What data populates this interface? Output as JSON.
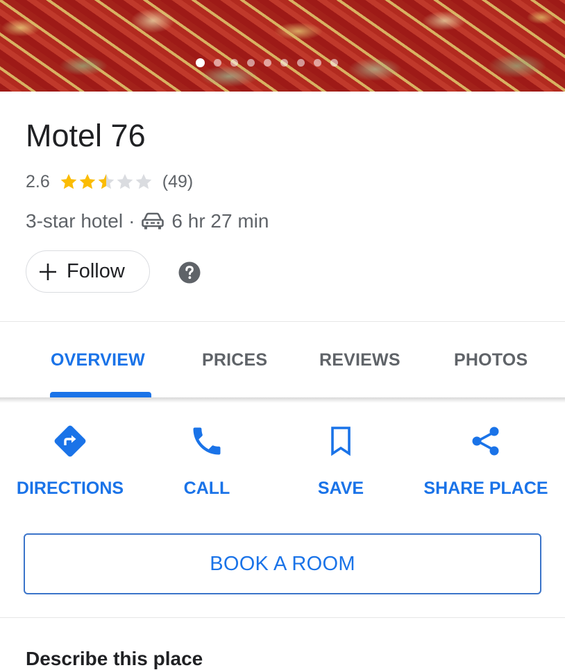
{
  "hero": {
    "image_count": 9,
    "active_index": 0
  },
  "place": {
    "name": "Motel 76",
    "rating": "2.6",
    "rating_value": 2.6,
    "review_count": "(49)",
    "category": "3-star hotel",
    "separator": "·",
    "drive_time": "6 hr 27 min"
  },
  "follow": {
    "label": "Follow"
  },
  "tabs": [
    {
      "label": "OVERVIEW",
      "active": true
    },
    {
      "label": "PRICES",
      "active": false
    },
    {
      "label": "REVIEWS",
      "active": false
    },
    {
      "label": "PHOTOS",
      "active": false
    }
  ],
  "actions": [
    {
      "label": "DIRECTIONS",
      "icon": "directions-icon"
    },
    {
      "label": "CALL",
      "icon": "phone-icon"
    },
    {
      "label": "SAVE",
      "icon": "bookmark-icon"
    },
    {
      "label": "SHARE PLACE",
      "icon": "share-icon"
    }
  ],
  "book": {
    "label": "BOOK A ROOM"
  },
  "describe": {
    "heading": "Describe this place"
  },
  "colors": {
    "accent": "#1a73e8",
    "star_filled": "#fbbc04",
    "star_empty": "#dadce0",
    "secondary_text": "#5f6368",
    "primary_text": "#202124"
  }
}
